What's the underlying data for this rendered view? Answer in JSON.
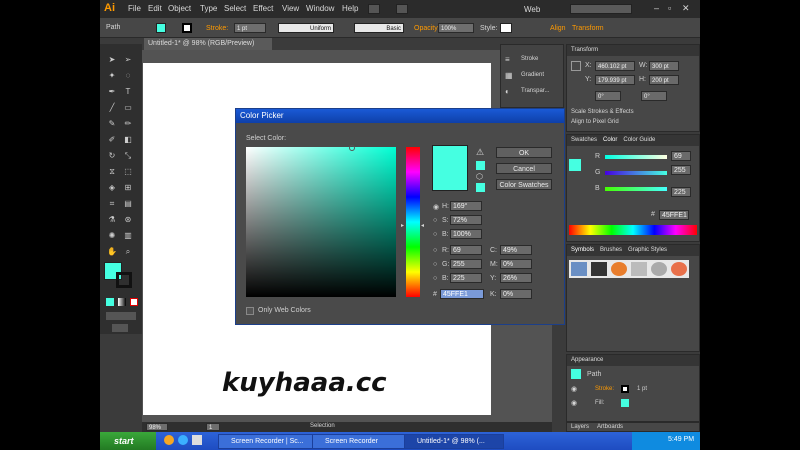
{
  "app": {
    "logo": "Ai"
  },
  "menu": [
    "File",
    "Edit",
    "Object",
    "Type",
    "Select",
    "Effect",
    "View",
    "Window",
    "Help"
  ],
  "workspace": {
    "label": "Web",
    "search_placeholder": ""
  },
  "control_bar": {
    "selection_label": "Path",
    "stroke_label": "Stroke:",
    "stroke_weight": "1 pt",
    "profile": "Uniform",
    "brush": "Basic",
    "opacity_label": "Opacity:",
    "opacity_value": "100%",
    "style_label": "Style:",
    "align_label": "Align",
    "transform_label": "Transform"
  },
  "document_tab": "Untitled-1* @ 98% (RGB/Preview)",
  "mid_panel": [
    "Stroke",
    "Gradient",
    "Transpar..."
  ],
  "transform_panel": {
    "title": "Transform",
    "x": "460.102 pt",
    "w": "300 pt",
    "y": "179.939 pt",
    "h": "200 pt",
    "angle": "0°",
    "shear": "0°",
    "scale_strokes": "Scale Strokes & Effects",
    "align_pixel": "Align to Pixel Grid"
  },
  "color_panel": {
    "tabs": [
      "Swatches",
      "Color",
      "Color Guide"
    ],
    "r": "69",
    "g": "255",
    "b": "225",
    "hex": "45FFE1"
  },
  "symbols_panel": {
    "tabs": [
      "Symbols",
      "Brushes",
      "Graphic Styles"
    ]
  },
  "appearance_panel": {
    "title": "Appearance",
    "object": "Path",
    "stroke_label": "Stroke:",
    "stroke_value": "1 pt",
    "fill_label": "Fill:"
  },
  "bottom_tabs": [
    "Layers",
    "Artboards"
  ],
  "status": {
    "zoom": "98%",
    "page": "1",
    "mode": "Selection"
  },
  "dialog": {
    "title": "Color Picker",
    "select_label": "Select Color:",
    "ok": "OK",
    "cancel": "Cancel",
    "swatches": "Color Swatches",
    "h_label": "H:",
    "h_value": "169°",
    "s_label": "S:",
    "s_value": "72%",
    "b_label": "B:",
    "b_value": "100%",
    "r_label": "R:",
    "r_value": "69",
    "g_label": "G:",
    "g_value": "255",
    "bb_label": "B:",
    "bb_value": "225",
    "c_label": "C:",
    "c_value": "49%",
    "m_label": "M:",
    "m_value": "0%",
    "y_label": "Y:",
    "y_value": "26%",
    "k_label": "K:",
    "k_value": "0%",
    "hex_label": "#",
    "hex_value": "45FFE1",
    "web_only": "Only Web Colors",
    "current_color": "#45FFE1"
  },
  "watermark": "kuyhaaa.cc",
  "taskbar": {
    "start": "start",
    "tasks": [
      "Screen Recorder | Sc...",
      "Screen Recorder",
      "Untitled-1* @ 98% (..."
    ],
    "clock": "5:49 PM"
  },
  "colors": {
    "accent": "#45FFE1",
    "titlebar": "#0e3fa8",
    "taskbar": "#2d63d8"
  }
}
